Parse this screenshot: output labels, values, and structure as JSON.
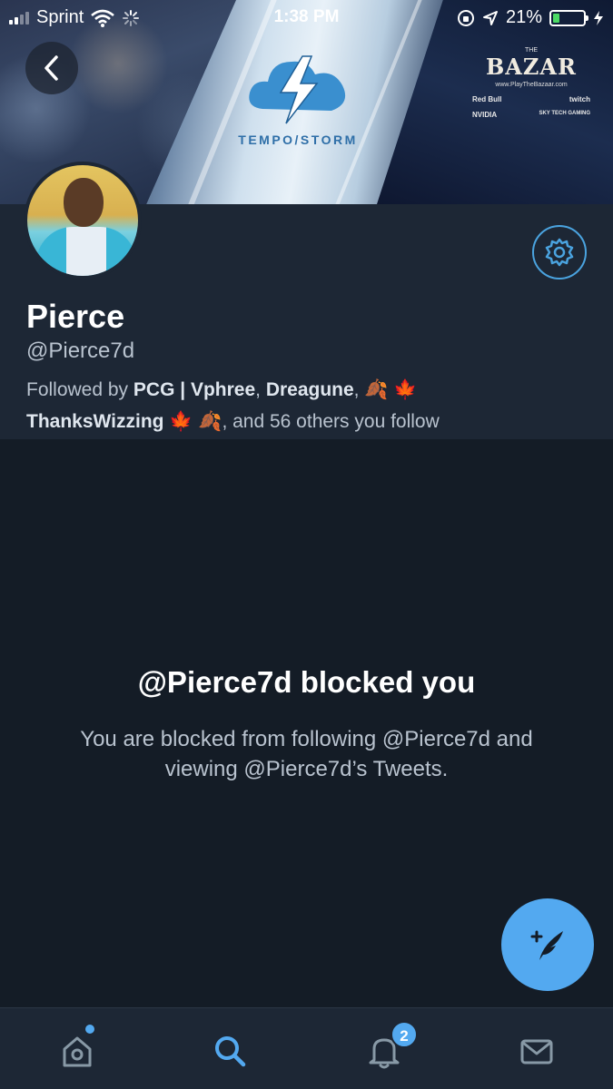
{
  "status_bar": {
    "carrier": "Sprint",
    "time": "1:38 PM",
    "battery_percent": "21%",
    "battery_level": 0.21
  },
  "banner": {
    "brand_text": "TEMPO/STORM",
    "sponsor_main": "BAZAR",
    "sponsor_prefix": "THE",
    "sponsor_url": "www.PlayTheBazaar.com",
    "sponsors": [
      "Red Bull",
      "twitch",
      "NVIDIA",
      "SKY TECH GAMING"
    ]
  },
  "profile": {
    "name": "Pierce",
    "handle": "@Pierce7d",
    "followed_prefix": "Followed by ",
    "followed_user_1": "PCG | Vphree",
    "separator_1": ", ",
    "followed_user_2": "Dreagune",
    "separator_2": ", ",
    "emoji_a": "🍂 🍁",
    "followed_user_3": "ThanksWizzing",
    "emoji_b": " 🍁 🍂",
    "followed_suffix": ", and 56 others you follow"
  },
  "blocked": {
    "title": "@Pierce7d blocked you",
    "description": "You are blocked from following @Pierce7d and viewing @Pierce7d’s Tweets."
  },
  "tabbar": {
    "notifications_badge": "2",
    "accent": "#53a9f0"
  },
  "icons": {
    "back": "back-arrow-icon",
    "settings": "gear-icon",
    "compose": "compose-tweet-icon",
    "home": "home-icon",
    "search": "search-icon",
    "notifications": "bell-icon",
    "messages": "mail-icon"
  }
}
